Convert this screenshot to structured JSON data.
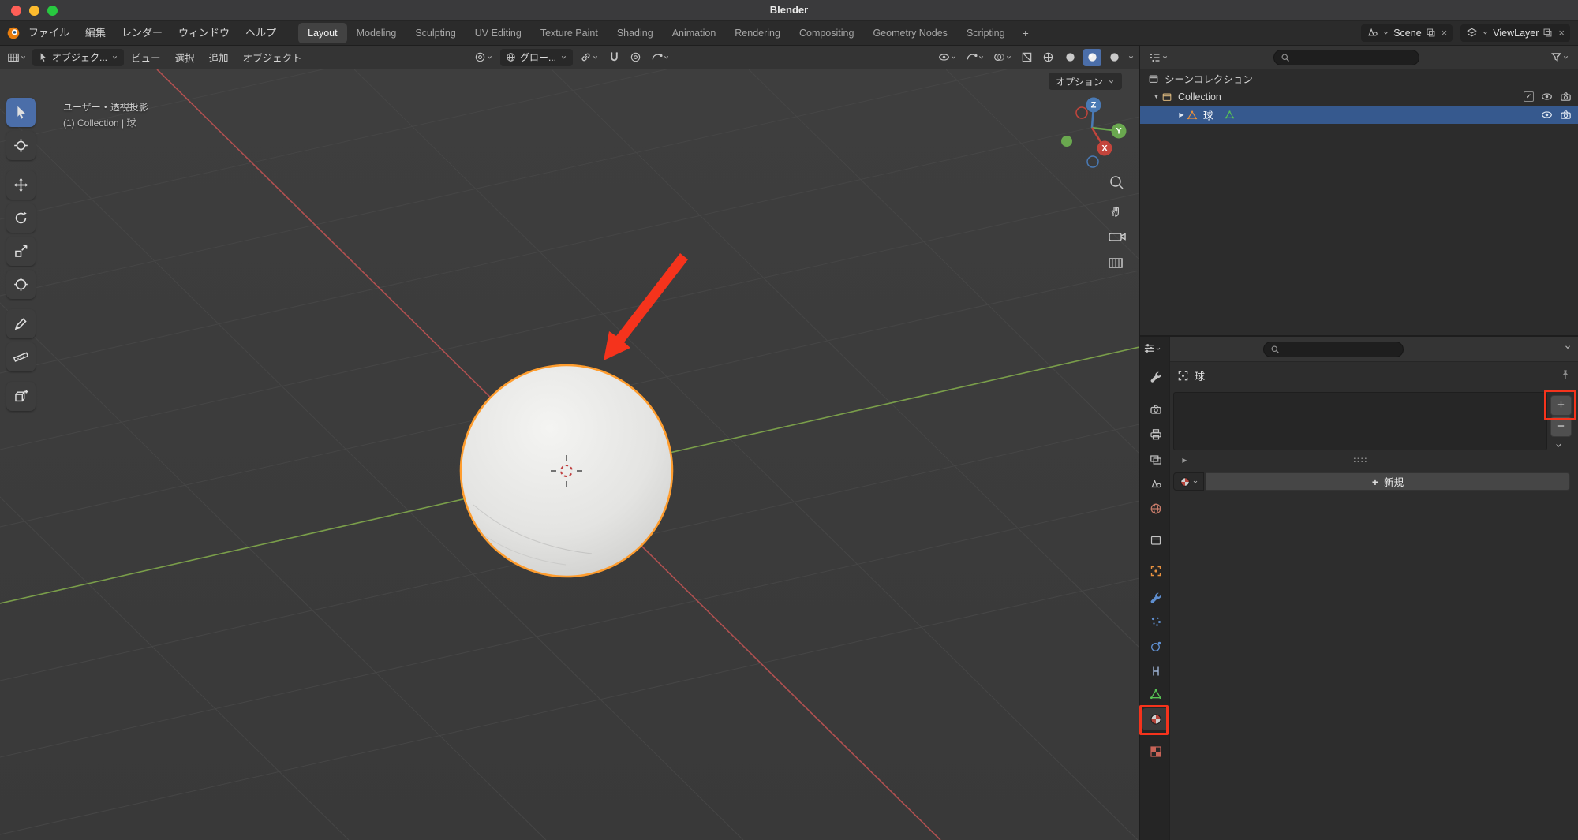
{
  "titlebar": {
    "title": "Blender"
  },
  "topbar": {
    "menus": [
      "ファイル",
      "編集",
      "レンダー",
      "ウィンドウ",
      "ヘルプ"
    ],
    "workspaces": [
      "Layout",
      "Modeling",
      "Sculpting",
      "UV Editing",
      "Texture Paint",
      "Shading",
      "Animation",
      "Rendering",
      "Compositing",
      "Geometry Nodes",
      "Scripting"
    ],
    "active_workspace": "Layout",
    "add_workspace": "+",
    "scene": "Scene",
    "view_layer": "ViewLayer"
  },
  "viewport": {
    "header": {
      "mode": "オブジェク...",
      "menu_view": "ビュー",
      "menu_select": "選択",
      "menu_add": "追加",
      "menu_object": "オブジェクト",
      "orientation": "グロー...",
      "options": "オプション"
    },
    "overlay": {
      "line1": "ユーザー・透視投影",
      "line2": "(1) Collection | 球"
    },
    "gizmo": {
      "x": "X",
      "y": "Y",
      "z": "Z"
    }
  },
  "outliner": {
    "scene_collection": "シーンコレクション",
    "collection": "Collection",
    "object": "球"
  },
  "properties": {
    "object_name": "球",
    "new_material": "新規"
  },
  "colors": {
    "annotation_red": "#f5331c",
    "selection_outline_orange": "#ff9d2e",
    "selected_row_blue": "#36598e",
    "active_tool_blue": "#4b6ea9",
    "axis_x_red": "#b05050",
    "axis_y_green": "#7a9e4a",
    "traffic_close": "#ff5f57",
    "traffic_minimize": "#febc2e",
    "traffic_zoom": "#28c840"
  }
}
